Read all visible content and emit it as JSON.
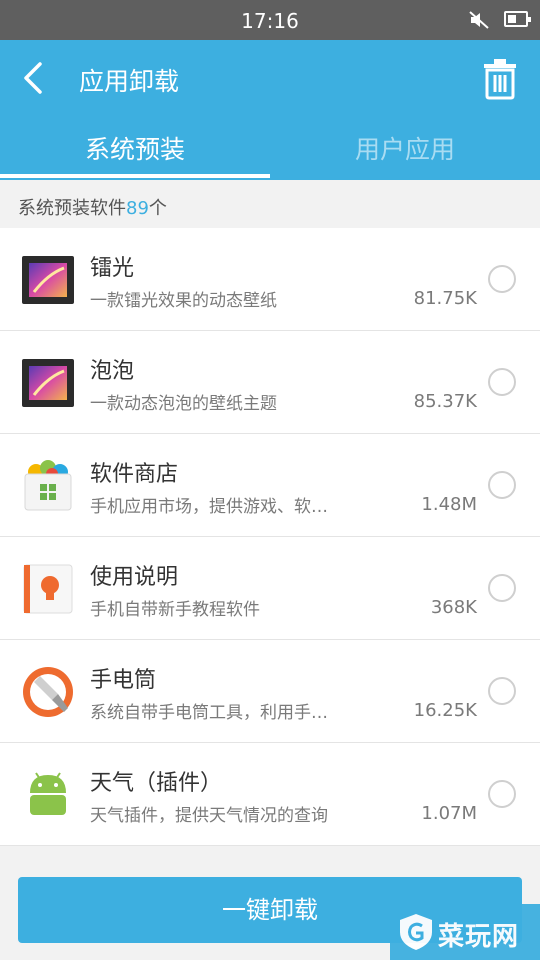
{
  "status": {
    "time": "17:16"
  },
  "header": {
    "title": "应用卸载"
  },
  "tabs": [
    {
      "label": "系统预装",
      "active": true
    },
    {
      "label": "用户应用",
      "active": false
    }
  ],
  "count": {
    "prefix": "系统预装软件",
    "number": "89",
    "suffix": "个"
  },
  "apps": [
    {
      "name": "镭光",
      "desc": "一款镭光效果的动态壁纸",
      "size": "81.75K",
      "icon": "wallpaper-icon"
    },
    {
      "name": "泡泡",
      "desc": "一款动态泡泡的壁纸主题",
      "size": "85.37K",
      "icon": "wallpaper-icon"
    },
    {
      "name": "软件商店",
      "desc": "手机应用市场，提供游戏、软…",
      "size": "1.48M",
      "icon": "app-store-icon"
    },
    {
      "name": "使用说明",
      "desc": "手机自带新手教程软件",
      "size": "368K",
      "icon": "manual-icon"
    },
    {
      "name": "手电筒",
      "desc": "系统自带手电筒工具，利用手…",
      "size": "16.25K",
      "icon": "flashlight-icon"
    },
    {
      "name": "天气（插件）",
      "desc": "天气插件，提供天气情况的查询",
      "size": "1.07M",
      "icon": "android-icon"
    }
  ],
  "bottom": {
    "button_label": "一键卸载"
  },
  "watermark": {
    "text": "菜玩网"
  },
  "colors": {
    "accent": "#3dafe0",
    "status_bar": "#5f5f5f"
  }
}
